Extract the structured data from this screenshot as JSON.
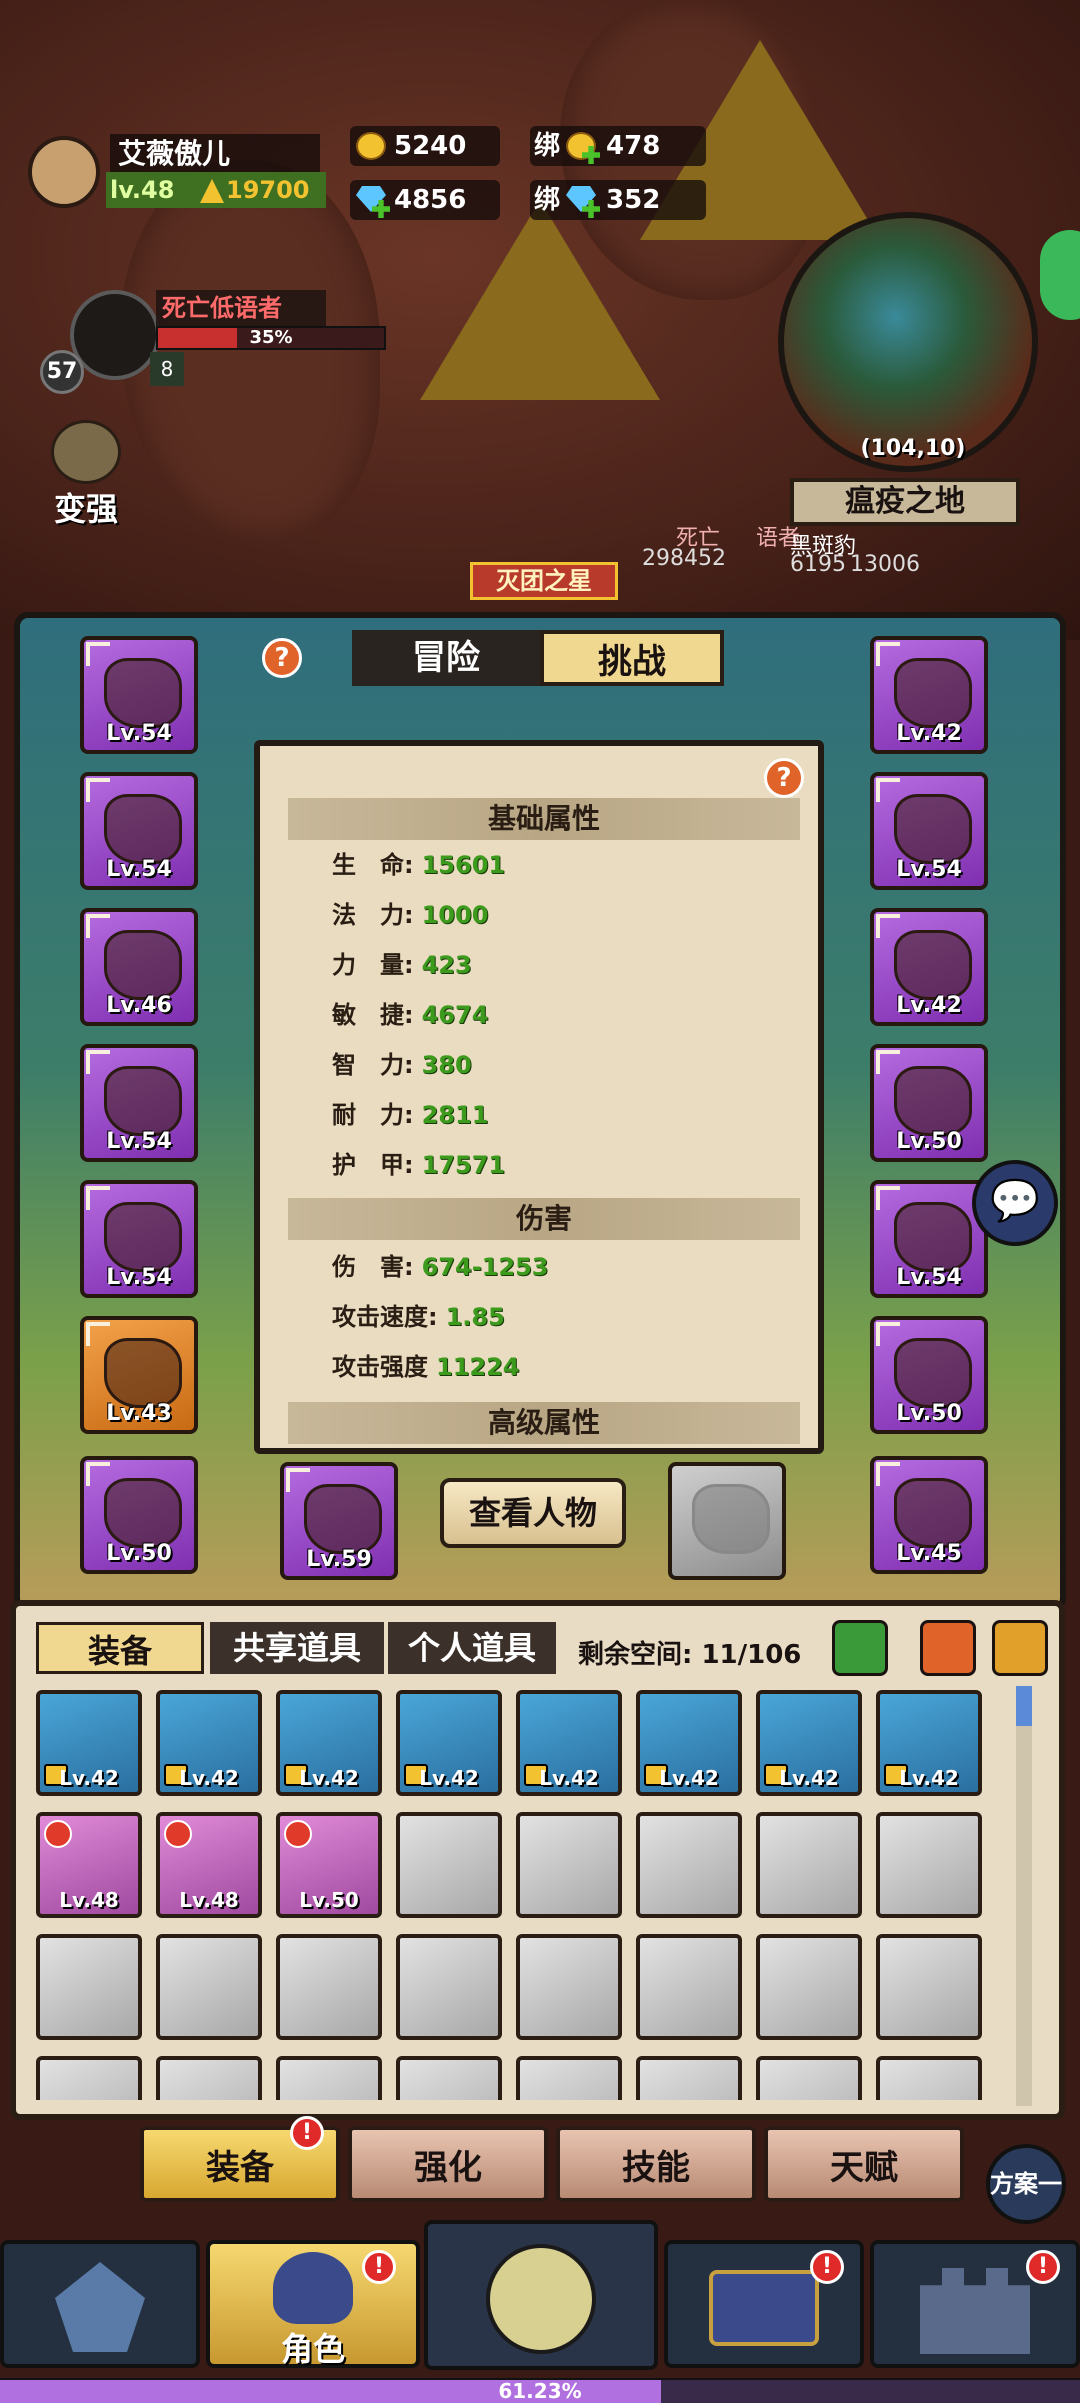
{
  "player": {
    "name": "艾薇傲儿",
    "level": "lv.48",
    "power": "19700"
  },
  "currency": {
    "gold": "5240",
    "bound_gold_prefix": "绑",
    "bound_gold": "478",
    "diamonds": "4856",
    "bound_diamond_prefix": "绑",
    "bound_diamond": "352"
  },
  "boss": {
    "name": "死亡低语者",
    "progress_label": "35%",
    "progress": 0.35,
    "level": "57",
    "count": "8"
  },
  "strengthen_label": "变强",
  "minimap": {
    "coords": "(104,10)",
    "zone": "瘟疫之地"
  },
  "world_labels": {
    "banner": "灭团之星",
    "npc1": "死亡",
    "npc1b": "语者",
    "npc2": "黑斑豹",
    "num1": "298452",
    "num2": "6195",
    "num3": "13006"
  },
  "panel_tabs": {
    "adventure": "冒险",
    "challenge": "挑战"
  },
  "left_slots": [
    "Lv.54",
    "Lv.54",
    "Lv.46",
    "Lv.54",
    "Lv.54",
    "Lv.43",
    "Lv.50"
  ],
  "right_slots": [
    "Lv.42",
    "Lv.54",
    "Lv.42",
    "Lv.50",
    "Lv.54",
    "Lv.50",
    "Lv.45"
  ],
  "weapon_slot": "Lv.59",
  "view_character": "查看人物",
  "stats": {
    "basic_title": "基础属性",
    "basic": [
      {
        "label": "生　命:",
        "value": "15601"
      },
      {
        "label": "法　力:",
        "value": "1000"
      },
      {
        "label": "力　量:",
        "value": "423"
      },
      {
        "label": "敏　捷:",
        "value": "4674"
      },
      {
        "label": "智　力:",
        "value": "380"
      },
      {
        "label": "耐　力:",
        "value": "2811"
      },
      {
        "label": "护　甲:",
        "value": "17571"
      }
    ],
    "damage_title": "伤害",
    "damage": [
      {
        "label": "伤　害:",
        "value": "674-1253"
      },
      {
        "label": "攻击速度:",
        "value": "1.85"
      },
      {
        "label": "攻击强度",
        "value": "11224"
      }
    ],
    "advanced_title": "高级属性"
  },
  "inventory": {
    "tabs": {
      "equipment": "装备",
      "shared": "共享道具",
      "personal": "个人道具"
    },
    "space_label": "剩余空间: 11/106",
    "row1": [
      "Lv.42",
      "Lv.42",
      "Lv.42",
      "Lv.42",
      "Lv.42",
      "Lv.42",
      "Lv.42",
      "Lv.42"
    ],
    "row2": [
      "Lv.48",
      "Lv.48",
      "Lv.50"
    ]
  },
  "bottom_tabs": {
    "equip": "装备",
    "enhance": "强化",
    "skills": "技能",
    "talent": "天赋",
    "plan": "方案一"
  },
  "nav": {
    "character": "角色"
  },
  "exp_label": "61.23%",
  "exp": 0.6123,
  "colors": {
    "accent_gold": "#f2c230",
    "stat_green": "#3c9a1c",
    "epic_purple": "#9b45c8"
  }
}
